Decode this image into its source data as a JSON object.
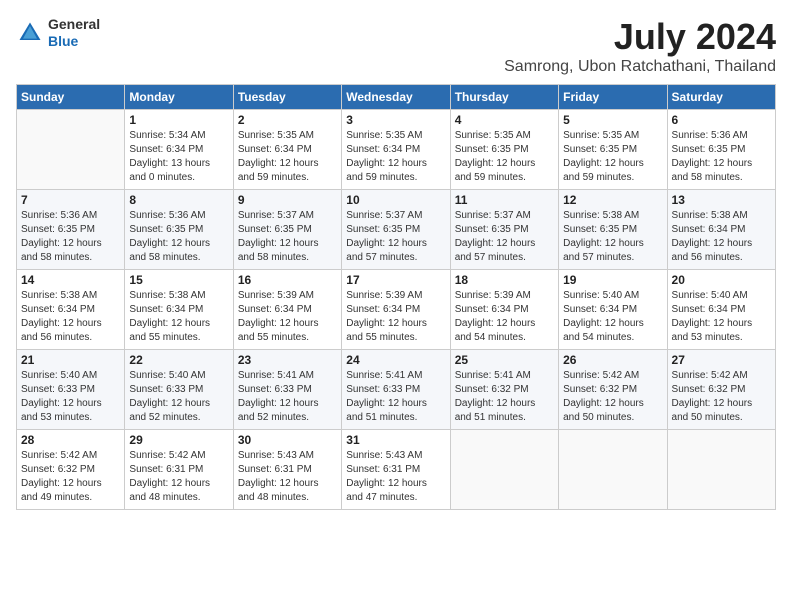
{
  "header": {
    "logo_general": "General",
    "logo_blue": "Blue",
    "title": "July 2024",
    "subtitle": "Samrong, Ubon Ratchathani, Thailand"
  },
  "days_of_week": [
    "Sunday",
    "Monday",
    "Tuesday",
    "Wednesday",
    "Thursday",
    "Friday",
    "Saturday"
  ],
  "weeks": [
    [
      {
        "day": "",
        "sunrise": "",
        "sunset": "",
        "daylight": ""
      },
      {
        "day": "1",
        "sunrise": "Sunrise: 5:34 AM",
        "sunset": "Sunset: 6:34 PM",
        "daylight": "Daylight: 13 hours and 0 minutes."
      },
      {
        "day": "2",
        "sunrise": "Sunrise: 5:35 AM",
        "sunset": "Sunset: 6:34 PM",
        "daylight": "Daylight: 12 hours and 59 minutes."
      },
      {
        "day": "3",
        "sunrise": "Sunrise: 5:35 AM",
        "sunset": "Sunset: 6:34 PM",
        "daylight": "Daylight: 12 hours and 59 minutes."
      },
      {
        "day": "4",
        "sunrise": "Sunrise: 5:35 AM",
        "sunset": "Sunset: 6:35 PM",
        "daylight": "Daylight: 12 hours and 59 minutes."
      },
      {
        "day": "5",
        "sunrise": "Sunrise: 5:35 AM",
        "sunset": "Sunset: 6:35 PM",
        "daylight": "Daylight: 12 hours and 59 minutes."
      },
      {
        "day": "6",
        "sunrise": "Sunrise: 5:36 AM",
        "sunset": "Sunset: 6:35 PM",
        "daylight": "Daylight: 12 hours and 58 minutes."
      }
    ],
    [
      {
        "day": "7",
        "sunrise": "Sunrise: 5:36 AM",
        "sunset": "Sunset: 6:35 PM",
        "daylight": "Daylight: 12 hours and 58 minutes."
      },
      {
        "day": "8",
        "sunrise": "Sunrise: 5:36 AM",
        "sunset": "Sunset: 6:35 PM",
        "daylight": "Daylight: 12 hours and 58 minutes."
      },
      {
        "day": "9",
        "sunrise": "Sunrise: 5:37 AM",
        "sunset": "Sunset: 6:35 PM",
        "daylight": "Daylight: 12 hours and 58 minutes."
      },
      {
        "day": "10",
        "sunrise": "Sunrise: 5:37 AM",
        "sunset": "Sunset: 6:35 PM",
        "daylight": "Daylight: 12 hours and 57 minutes."
      },
      {
        "day": "11",
        "sunrise": "Sunrise: 5:37 AM",
        "sunset": "Sunset: 6:35 PM",
        "daylight": "Daylight: 12 hours and 57 minutes."
      },
      {
        "day": "12",
        "sunrise": "Sunrise: 5:38 AM",
        "sunset": "Sunset: 6:35 PM",
        "daylight": "Daylight: 12 hours and 57 minutes."
      },
      {
        "day": "13",
        "sunrise": "Sunrise: 5:38 AM",
        "sunset": "Sunset: 6:34 PM",
        "daylight": "Daylight: 12 hours and 56 minutes."
      }
    ],
    [
      {
        "day": "14",
        "sunrise": "Sunrise: 5:38 AM",
        "sunset": "Sunset: 6:34 PM",
        "daylight": "Daylight: 12 hours and 56 minutes."
      },
      {
        "day": "15",
        "sunrise": "Sunrise: 5:38 AM",
        "sunset": "Sunset: 6:34 PM",
        "daylight": "Daylight: 12 hours and 55 minutes."
      },
      {
        "day": "16",
        "sunrise": "Sunrise: 5:39 AM",
        "sunset": "Sunset: 6:34 PM",
        "daylight": "Daylight: 12 hours and 55 minutes."
      },
      {
        "day": "17",
        "sunrise": "Sunrise: 5:39 AM",
        "sunset": "Sunset: 6:34 PM",
        "daylight": "Daylight: 12 hours and 55 minutes."
      },
      {
        "day": "18",
        "sunrise": "Sunrise: 5:39 AM",
        "sunset": "Sunset: 6:34 PM",
        "daylight": "Daylight: 12 hours and 54 minutes."
      },
      {
        "day": "19",
        "sunrise": "Sunrise: 5:40 AM",
        "sunset": "Sunset: 6:34 PM",
        "daylight": "Daylight: 12 hours and 54 minutes."
      },
      {
        "day": "20",
        "sunrise": "Sunrise: 5:40 AM",
        "sunset": "Sunset: 6:34 PM",
        "daylight": "Daylight: 12 hours and 53 minutes."
      }
    ],
    [
      {
        "day": "21",
        "sunrise": "Sunrise: 5:40 AM",
        "sunset": "Sunset: 6:33 PM",
        "daylight": "Daylight: 12 hours and 53 minutes."
      },
      {
        "day": "22",
        "sunrise": "Sunrise: 5:40 AM",
        "sunset": "Sunset: 6:33 PM",
        "daylight": "Daylight: 12 hours and 52 minutes."
      },
      {
        "day": "23",
        "sunrise": "Sunrise: 5:41 AM",
        "sunset": "Sunset: 6:33 PM",
        "daylight": "Daylight: 12 hours and 52 minutes."
      },
      {
        "day": "24",
        "sunrise": "Sunrise: 5:41 AM",
        "sunset": "Sunset: 6:33 PM",
        "daylight": "Daylight: 12 hours and 51 minutes."
      },
      {
        "day": "25",
        "sunrise": "Sunrise: 5:41 AM",
        "sunset": "Sunset: 6:32 PM",
        "daylight": "Daylight: 12 hours and 51 minutes."
      },
      {
        "day": "26",
        "sunrise": "Sunrise: 5:42 AM",
        "sunset": "Sunset: 6:32 PM",
        "daylight": "Daylight: 12 hours and 50 minutes."
      },
      {
        "day": "27",
        "sunrise": "Sunrise: 5:42 AM",
        "sunset": "Sunset: 6:32 PM",
        "daylight": "Daylight: 12 hours and 50 minutes."
      }
    ],
    [
      {
        "day": "28",
        "sunrise": "Sunrise: 5:42 AM",
        "sunset": "Sunset: 6:32 PM",
        "daylight": "Daylight: 12 hours and 49 minutes."
      },
      {
        "day": "29",
        "sunrise": "Sunrise: 5:42 AM",
        "sunset": "Sunset: 6:31 PM",
        "daylight": "Daylight: 12 hours and 48 minutes."
      },
      {
        "day": "30",
        "sunrise": "Sunrise: 5:43 AM",
        "sunset": "Sunset: 6:31 PM",
        "daylight": "Daylight: 12 hours and 48 minutes."
      },
      {
        "day": "31",
        "sunrise": "Sunrise: 5:43 AM",
        "sunset": "Sunset: 6:31 PM",
        "daylight": "Daylight: 12 hours and 47 minutes."
      },
      {
        "day": "",
        "sunrise": "",
        "sunset": "",
        "daylight": ""
      },
      {
        "day": "",
        "sunrise": "",
        "sunset": "",
        "daylight": ""
      },
      {
        "day": "",
        "sunrise": "",
        "sunset": "",
        "daylight": ""
      }
    ]
  ]
}
